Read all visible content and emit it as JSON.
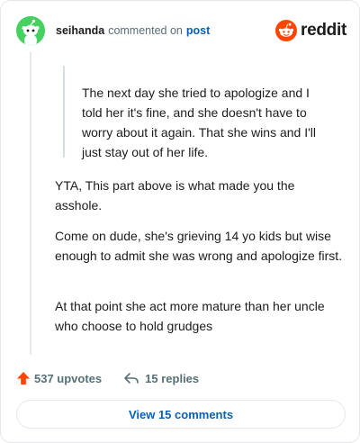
{
  "header": {
    "username": "seihanda",
    "action": "commented on",
    "post_link": "post",
    "brand": "reddit",
    "brand_color": "#ff4500",
    "avatar_color": "#46d160"
  },
  "quote": {
    "text": "The next day she tried to apologize and I told her it's fine, and she doesn't have to worry about it again. That she wins and I'll just stay out of her life."
  },
  "body": {
    "paragraphs": [
      "YTA, This part above is what made you the asshole.",
      "Come on dude, she's grieving 14 yo kids but wise enough to admit she was wrong and apologize first.",
      "At that point she act more mature than her uncle who choose to hold grudges"
    ]
  },
  "actions": {
    "upvotes": "537 upvotes",
    "replies": "15 replies",
    "upvote_icon": "upvote-arrow-icon",
    "reply_icon": "reply-arrow-icon"
  },
  "footer": {
    "view_comments": "View 15 comments",
    "link_color": "#0a5fb4"
  }
}
